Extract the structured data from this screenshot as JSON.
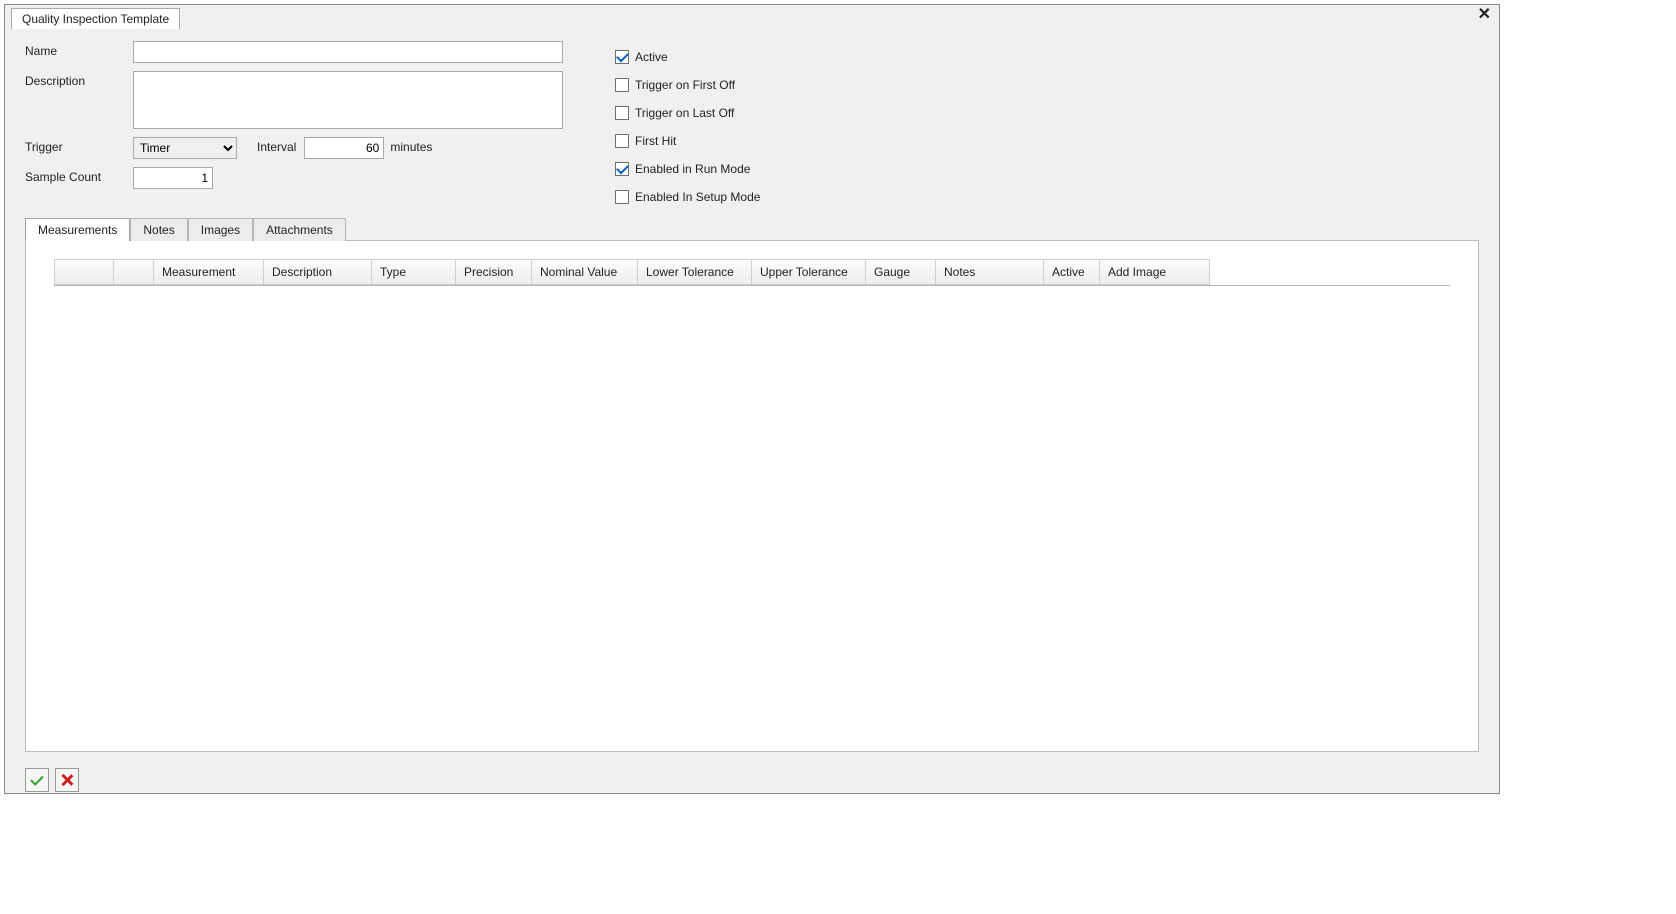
{
  "window": {
    "title": "Quality Inspection Template"
  },
  "form": {
    "name_label": "Name",
    "name_value": "",
    "description_label": "Description",
    "description_value": "",
    "trigger_label": "Trigger",
    "trigger_value": "Timer",
    "interval_label": "Interval",
    "interval_value": "60",
    "interval_units": "minutes",
    "sample_count_label": "Sample Count",
    "sample_count_value": "1"
  },
  "checkboxes": {
    "active": "Active",
    "trigger_first_off": "Trigger on First Off",
    "trigger_last_off": "Trigger on Last Off",
    "first_hit": "First Hit",
    "enabled_run": "Enabled in Run Mode",
    "enabled_setup": "Enabled In Setup Mode"
  },
  "subtabs": {
    "measurements": "Measurements",
    "notes": "Notes",
    "images": "Images",
    "attachments": "Attachments"
  },
  "grid": {
    "headers": {
      "blank1": "",
      "blank2": "",
      "measurement": "Measurement",
      "description": "Description",
      "type": "Type",
      "precision": "Precision",
      "nominal": "Nominal Value",
      "lower_tol": "Lower Tolerance",
      "upper_tol": "Upper Tolerance",
      "gauge": "Gauge",
      "notes": "Notes",
      "active": "Active",
      "add_image": "Add Image"
    }
  }
}
